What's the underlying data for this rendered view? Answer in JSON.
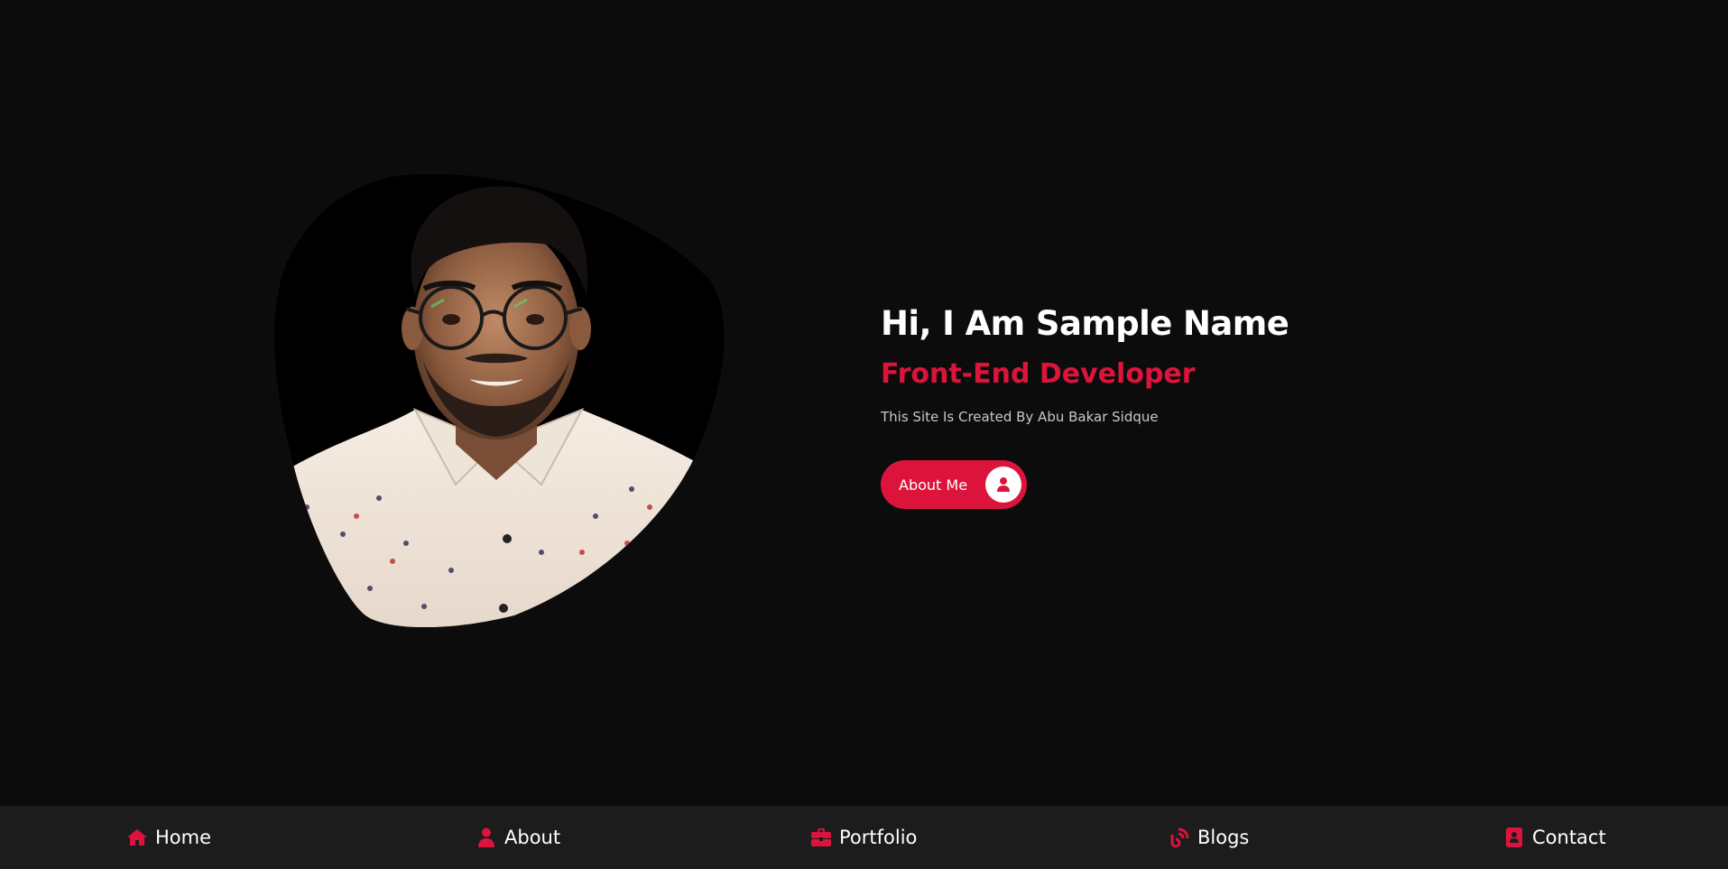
{
  "hero": {
    "title": "Hi, I Am Sample Name",
    "role": "Front-End Developer",
    "credit": "This Site Is Created By Abu Bakar Sidque",
    "button_label": "About Me",
    "button_icon": "user-icon"
  },
  "nav": {
    "items": [
      {
        "label": "Home",
        "icon": "home-icon"
      },
      {
        "label": "About",
        "icon": "user-icon"
      },
      {
        "label": "Portfolio",
        "icon": "briefcase-icon"
      },
      {
        "label": "Blogs",
        "icon": "blog-icon"
      },
      {
        "label": "Contact",
        "icon": "contact-book-icon"
      }
    ]
  },
  "colors": {
    "background": "#0c0c0c",
    "navbar": "#1c1c1c",
    "accent": "#dc143c",
    "text": "#ffffff",
    "muted_text": "#c8c8c8"
  }
}
